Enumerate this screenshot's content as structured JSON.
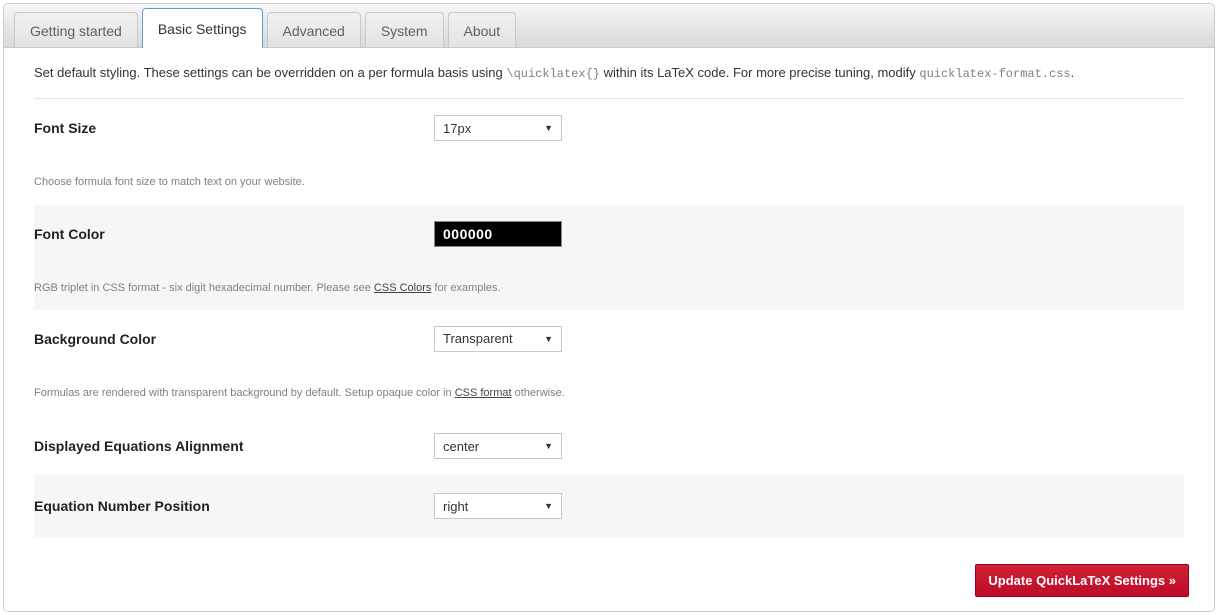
{
  "tabs": [
    {
      "label": "Getting started"
    },
    {
      "label": "Basic Settings"
    },
    {
      "label": "Advanced"
    },
    {
      "label": "System"
    },
    {
      "label": "About"
    }
  ],
  "intro": {
    "text_a": "Set default styling. These settings can be overridden on a per formula basis using ",
    "code_a": "\\quicklatex{}",
    "text_b": " within its LaTeX code. For more precise tuning, modify ",
    "code_b": "quicklatex-format.css",
    "text_c": "."
  },
  "rows": {
    "font_size": {
      "label": "Font Size",
      "value": "17px",
      "help": "Choose formula font size to match text on your website."
    },
    "font_color": {
      "label": "Font Color",
      "value": "000000",
      "help_a": "RGB triplet in CSS format - six digit hexadecimal number. Please see ",
      "help_link": "CSS Colors",
      "help_b": " for examples."
    },
    "bg_color": {
      "label": "Background Color",
      "value": "Transparent",
      "help_a": "Formulas are rendered with transparent background by default. Setup opaque color in ",
      "help_link": "CSS format",
      "help_b": " otherwise."
    },
    "alignment": {
      "label": "Displayed Equations Alignment",
      "value": "center"
    },
    "numpos": {
      "label": "Equation Number Position",
      "value": "right"
    }
  },
  "submit": {
    "label": "Update QuickLaTeX Settings »"
  }
}
